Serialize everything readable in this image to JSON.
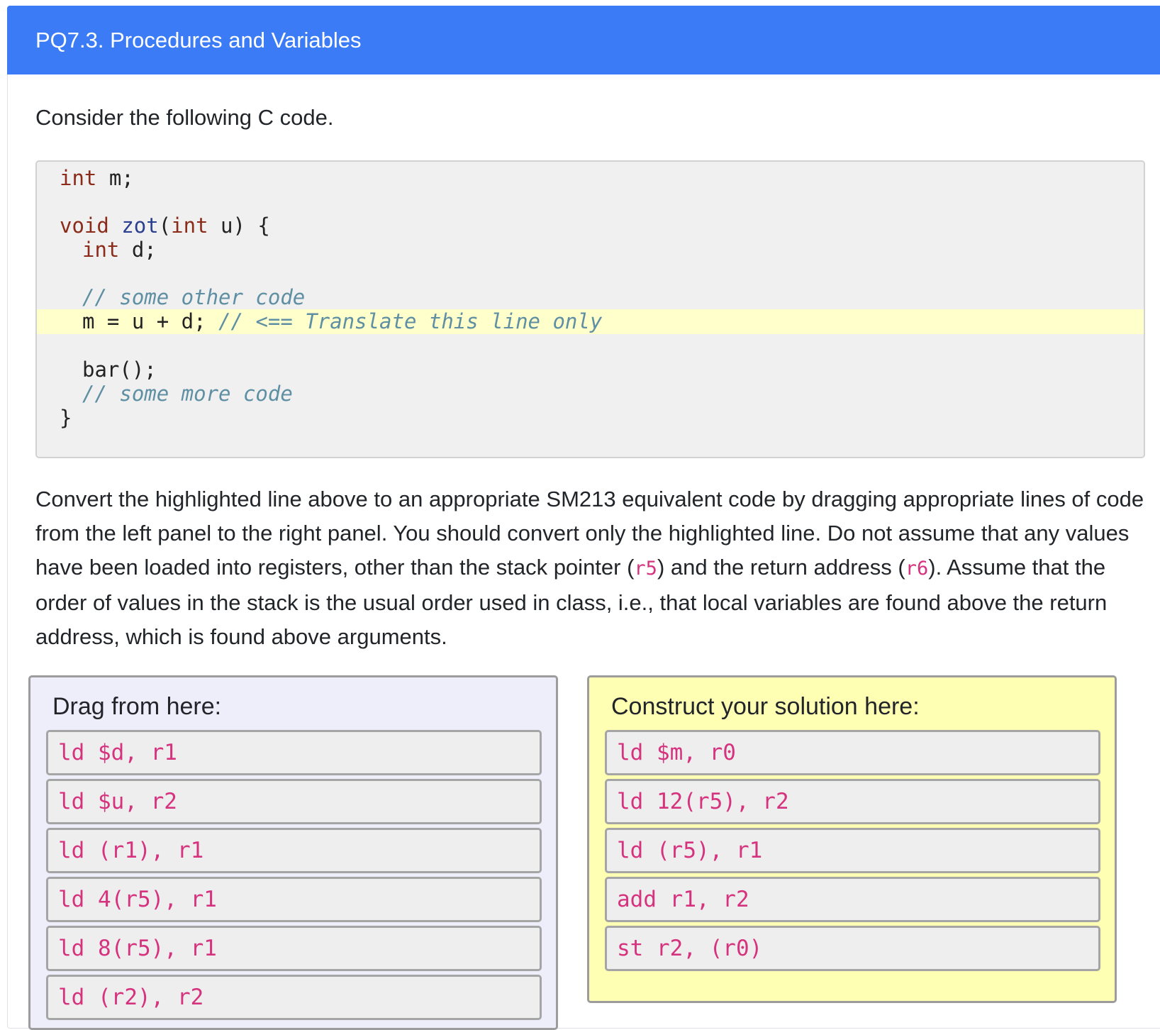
{
  "header": {
    "title": "PQ7.3. Procedures and Variables"
  },
  "intro": "Consider the following C code.",
  "code": {
    "l1_kw": "int",
    "l1_rest": " m;",
    "l3_kw1": "void",
    "l3_fn": "zot",
    "l3_p1": "(",
    "l3_kw2": "int",
    "l3_rest": " u) {",
    "l4_kw": "int",
    "l4_rest": " d;",
    "l6_comment": "// some other code",
    "l7_code": "m = u + d; ",
    "l7_comment": "// <== Translate this line only",
    "l9_code": "bar();",
    "l10_comment": "// some more code",
    "l11_code": "}"
  },
  "description": {
    "p1": "Convert the highlighted line above to an appropriate SM213 equivalent code by dragging appropriate lines of code from the left panel to the right panel. You should convert only the highlighted line. Do not assume that any values have been loaded into registers, other than the stack pointer (",
    "reg1": "r5",
    "p2": ") and the return address (",
    "reg2": "r6",
    "p3": "). Assume that the order of values in the stack is the usual order used in class, i.e., that local variables are found above the return address, which is found above arguments."
  },
  "source_panel": {
    "title": "Drag from here:",
    "blocks": [
      "ld $d, r1",
      "ld $u, r2",
      "ld (r1), r1",
      "ld 4(r5), r1",
      "ld 8(r5), r1",
      "ld (r2), r2"
    ]
  },
  "target_panel": {
    "title": "Construct your solution here:",
    "blocks": [
      "ld $m, r0",
      "ld 12(r5), r2",
      "ld (r5), r1",
      "add r1, r2",
      "st r2, (r0)"
    ]
  },
  "colors": {
    "header": "#3b7bf6",
    "highlight": "#ffffcc",
    "code_pink": "#d6337f"
  }
}
